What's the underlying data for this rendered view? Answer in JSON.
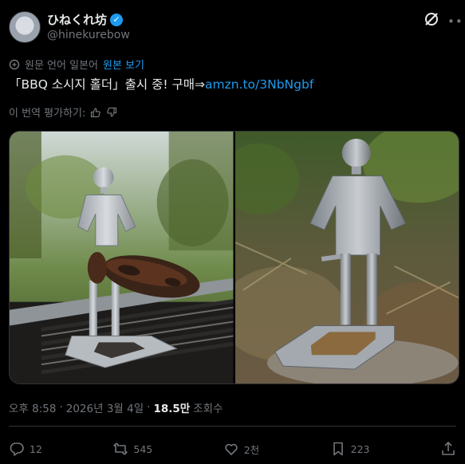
{
  "author": {
    "display_name": "ひねくれ坊",
    "handle": "@hinekurebow"
  },
  "translation": {
    "note": "원문 언어 일본어",
    "show_original": "원본 보기"
  },
  "post": {
    "text": "「BBQ 소시지 홀더」출시 중! 구매⇒",
    "link": "amzn.to/3NbNgbf"
  },
  "rate_translation": "이 번역 평가하기:",
  "meta": {
    "time": "오후 8:58",
    "sep1": "·",
    "date": "2026년 3월 4일",
    "sep2": "·",
    "views_count": "18.5만",
    "views_label": "조회수"
  },
  "actions": {
    "replies": "12",
    "reposts": "545",
    "likes": "2천",
    "bookmarks": "223"
  },
  "colors": {
    "background": "#000000",
    "accent": "#1d9bf0",
    "muted": "#71767b",
    "text": "#e7e9ea"
  }
}
